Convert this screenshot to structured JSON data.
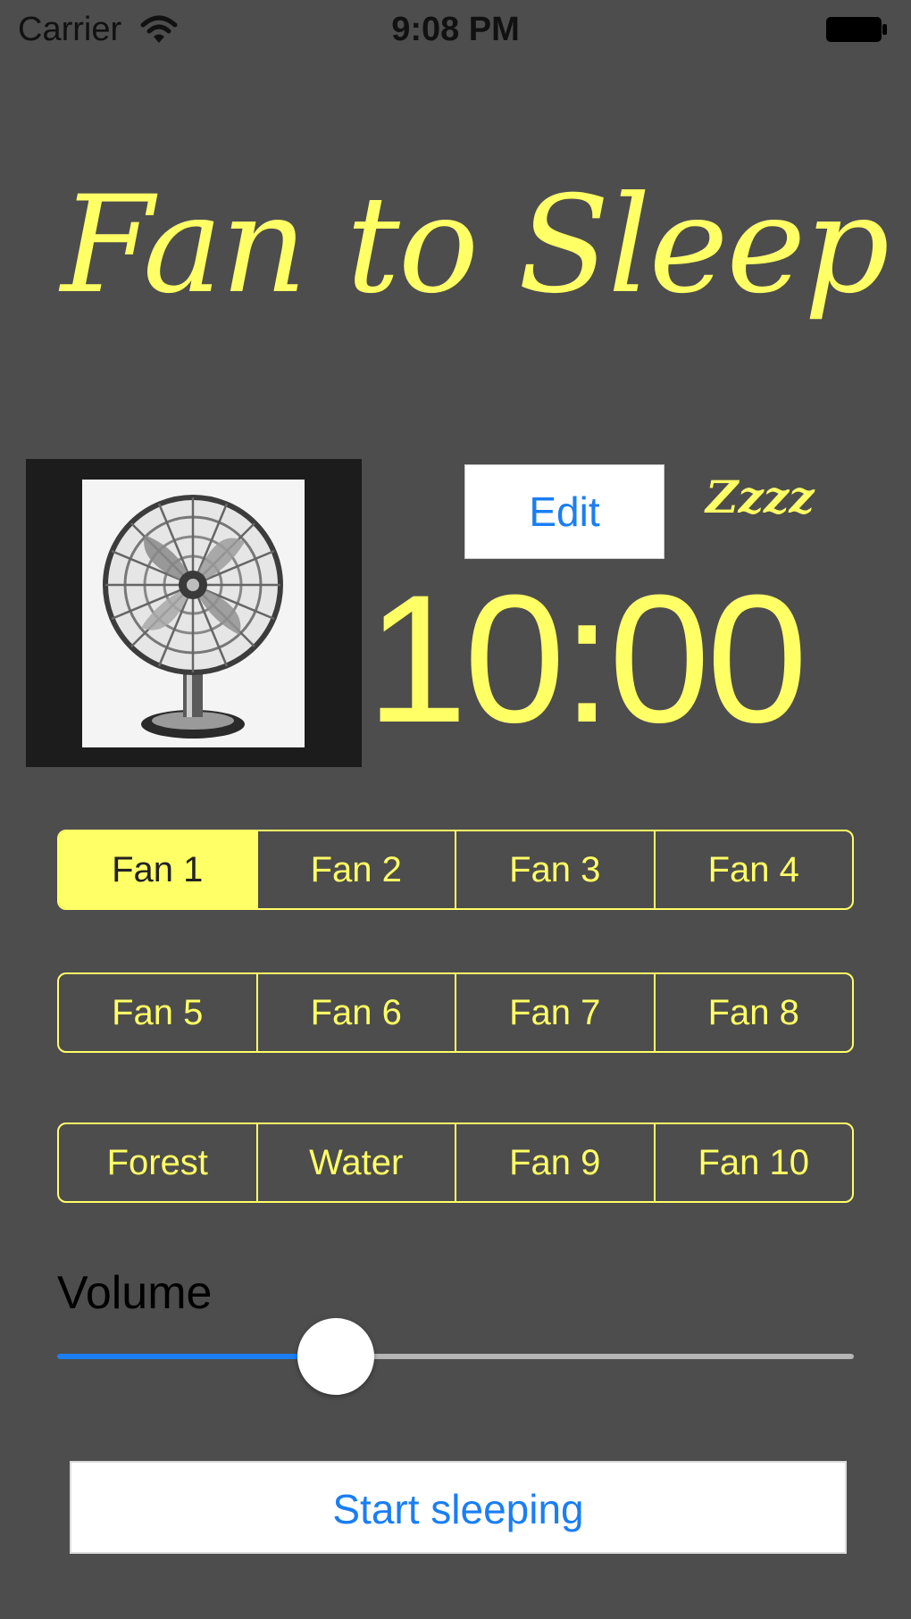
{
  "status_bar": {
    "carrier": "Carrier",
    "time": "9:08 PM"
  },
  "app": {
    "title": "Fan to Sleep"
  },
  "timer": {
    "edit_label": "Edit",
    "zzzz": "Zzzz",
    "value": "10:00"
  },
  "fan_rows": [
    {
      "segments": [
        {
          "label": "Fan 1",
          "selected": true
        },
        {
          "label": "Fan 2",
          "selected": false
        },
        {
          "label": "Fan 3",
          "selected": false
        },
        {
          "label": "Fan 4",
          "selected": false
        }
      ]
    },
    {
      "segments": [
        {
          "label": "Fan 5",
          "selected": false
        },
        {
          "label": "Fan 6",
          "selected": false
        },
        {
          "label": "Fan 7",
          "selected": false
        },
        {
          "label": "Fan 8",
          "selected": false
        }
      ]
    },
    {
      "segments": [
        {
          "label": "Forest",
          "selected": false
        },
        {
          "label": "Water",
          "selected": false
        },
        {
          "label": "Fan 9",
          "selected": false
        },
        {
          "label": "Fan 10",
          "selected": false
        }
      ]
    }
  ],
  "volume": {
    "label": "Volume",
    "value": 0.35
  },
  "actions": {
    "start_label": "Start sleeping"
  },
  "colors": {
    "background": "#4d4d4d",
    "accent": "#ffff66",
    "tint": "#1a7ef5"
  },
  "icons": {
    "wifi": "wifi-icon",
    "battery": "battery-icon",
    "fan_image": "fan-image"
  }
}
